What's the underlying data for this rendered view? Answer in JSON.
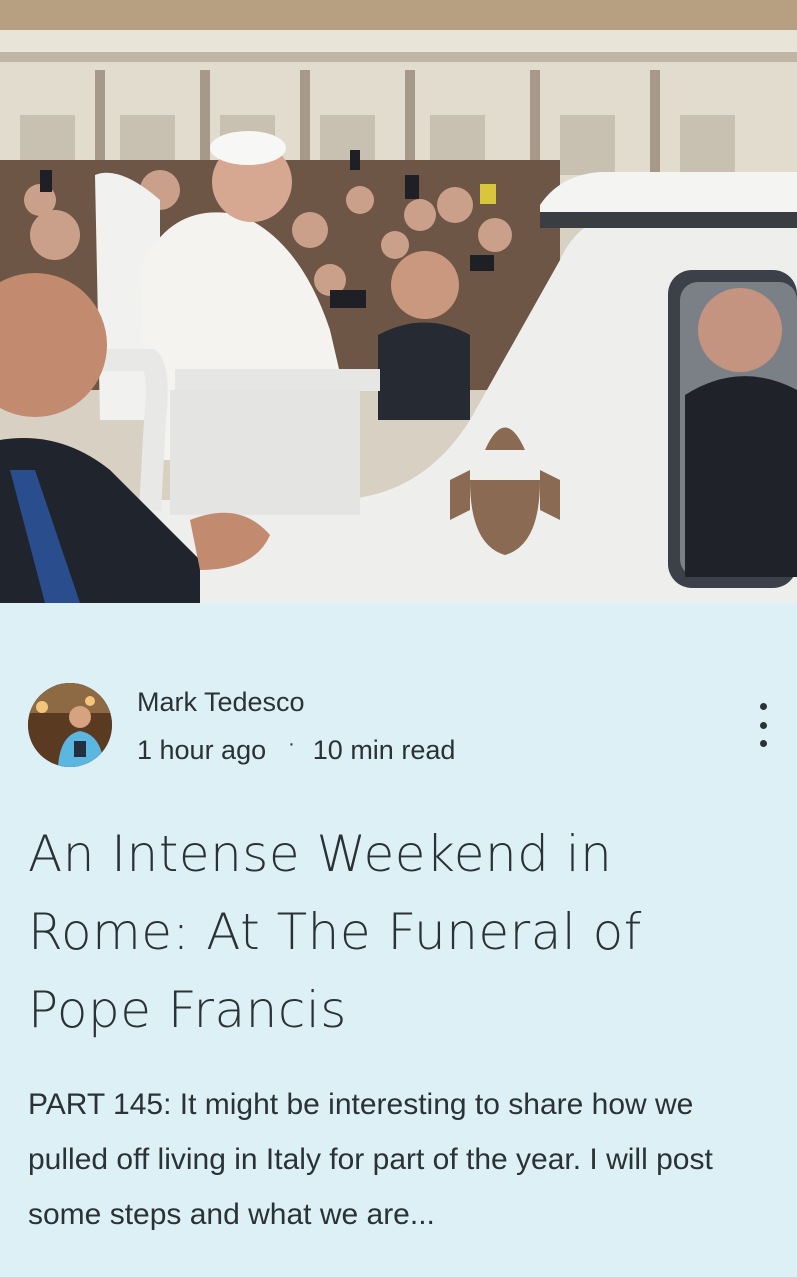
{
  "post": {
    "hero_image_icon": "photo-pope-francis-popemobile",
    "author_name": "Mark Tedesco",
    "avatar_icon": "author-avatar",
    "time_ago": "1 hour ago",
    "separator": "·",
    "read_time": "10 min read",
    "more_icon": "more-vertical-icon",
    "title": "An Intense Weekend in Rome: At The Funeral of Pope Francis",
    "excerpt": "PART 145: It might be interesting to share how we pulled off living in Italy for part of the year. I will post some steps and what we are..."
  },
  "colors": {
    "card_background": "#dcf0f6",
    "text": "#2b3236"
  }
}
